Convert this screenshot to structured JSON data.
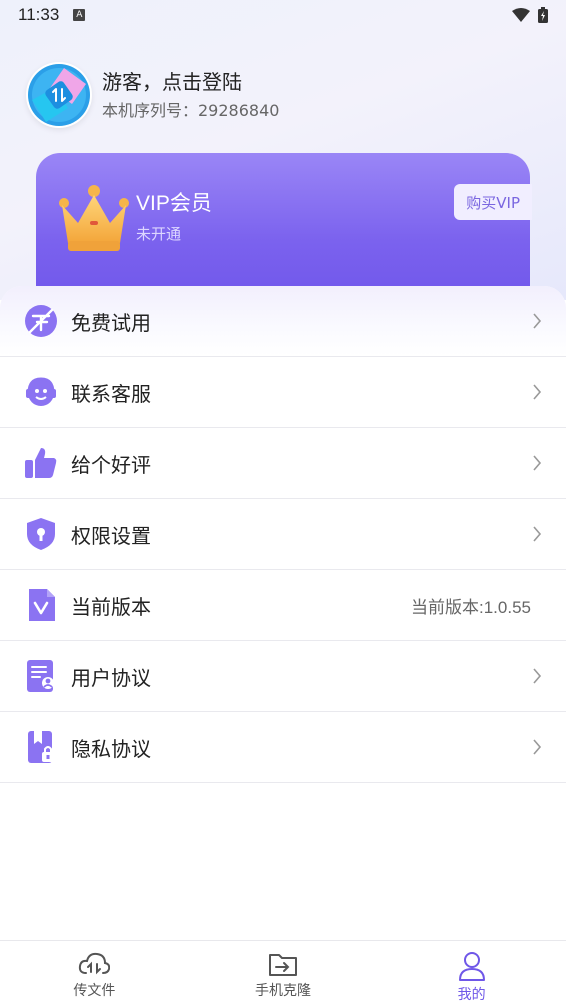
{
  "status_bar": {
    "time": "11:33",
    "badge": "A"
  },
  "profile": {
    "name": "游客，点击登陆",
    "serial": "本机序列号：29286840"
  },
  "vip": {
    "title": "VIP会员",
    "status": "未开通",
    "buy_label": "购买VIP"
  },
  "menu": {
    "items": [
      {
        "label": "免费试用",
        "icon": "free-trial-icon"
      },
      {
        "label": "联系客服",
        "icon": "customer-service-icon"
      },
      {
        "label": "给个好评",
        "icon": "thumbs-up-icon"
      },
      {
        "label": "权限设置",
        "icon": "shield-icon"
      },
      {
        "label": "当前版本",
        "icon": "version-icon",
        "value": "当前版本:1.0.55"
      },
      {
        "label": "用户协议",
        "icon": "user-agreement-icon"
      },
      {
        "label": "隐私协议",
        "icon": "privacy-icon"
      }
    ]
  },
  "tabs": [
    {
      "label": "传文件",
      "icon": "cloud-transfer-icon",
      "active": false
    },
    {
      "label": "手机克隆",
      "icon": "folder-transfer-icon",
      "active": false
    },
    {
      "label": "我的",
      "icon": "person-icon",
      "active": true
    }
  ],
  "colors": {
    "accent": "#6f57e8",
    "icon_purple": "#8b73f2",
    "vip_gradient_top": "#9a86f6",
    "vip_gradient_bottom": "#6e55ea"
  }
}
